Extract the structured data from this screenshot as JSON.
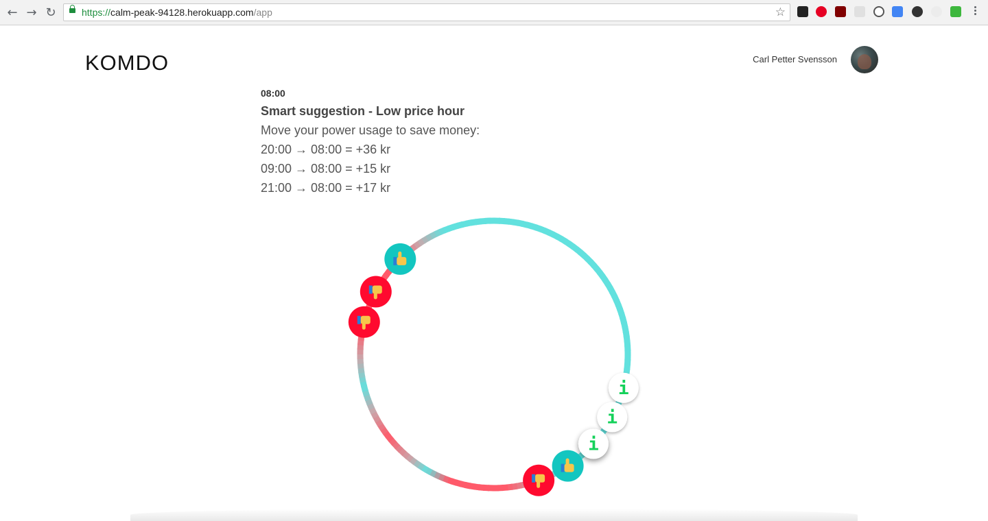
{
  "browser": {
    "url_protocol": "https://",
    "url_host": "calm-peak-94128.herokuapp.com",
    "url_path": "/app"
  },
  "header": {
    "logo": "KOMDO",
    "user_name": "Carl Petter Svensson"
  },
  "suggestion": {
    "time": "08:00",
    "title": "Smart suggestion - Low price hour",
    "subtitle": "Move your power usage to save money:",
    "moves": [
      "20:00 → 08:00 = +36 kr",
      "09:00 → 08:00 = +15 kr",
      "21:00 → 08:00 = +17 kr"
    ]
  },
  "clock": {
    "colors": {
      "low": "#62e1de",
      "high": "#ff5a6a",
      "mid": "#c7a9ad"
    },
    "markers": [
      {
        "kind": "thumbs-up",
        "color": "#13c6c0"
      },
      {
        "kind": "thumbs-down",
        "color": "#ff0a2f"
      },
      {
        "kind": "thumbs-down",
        "color": "#ff0a2f"
      },
      {
        "kind": "info",
        "label": "i",
        "color": "#ffffff",
        "glyph_color": "#14d15a"
      },
      {
        "kind": "info",
        "label": "i",
        "color": "#ffffff",
        "glyph_color": "#14d15a"
      },
      {
        "kind": "info",
        "label": "i",
        "color": "#ffffff",
        "glyph_color": "#14d15a"
      },
      {
        "kind": "thumbs-up",
        "color": "#13c6c0"
      },
      {
        "kind": "thumbs-down",
        "color": "#ff0a2f"
      }
    ]
  }
}
